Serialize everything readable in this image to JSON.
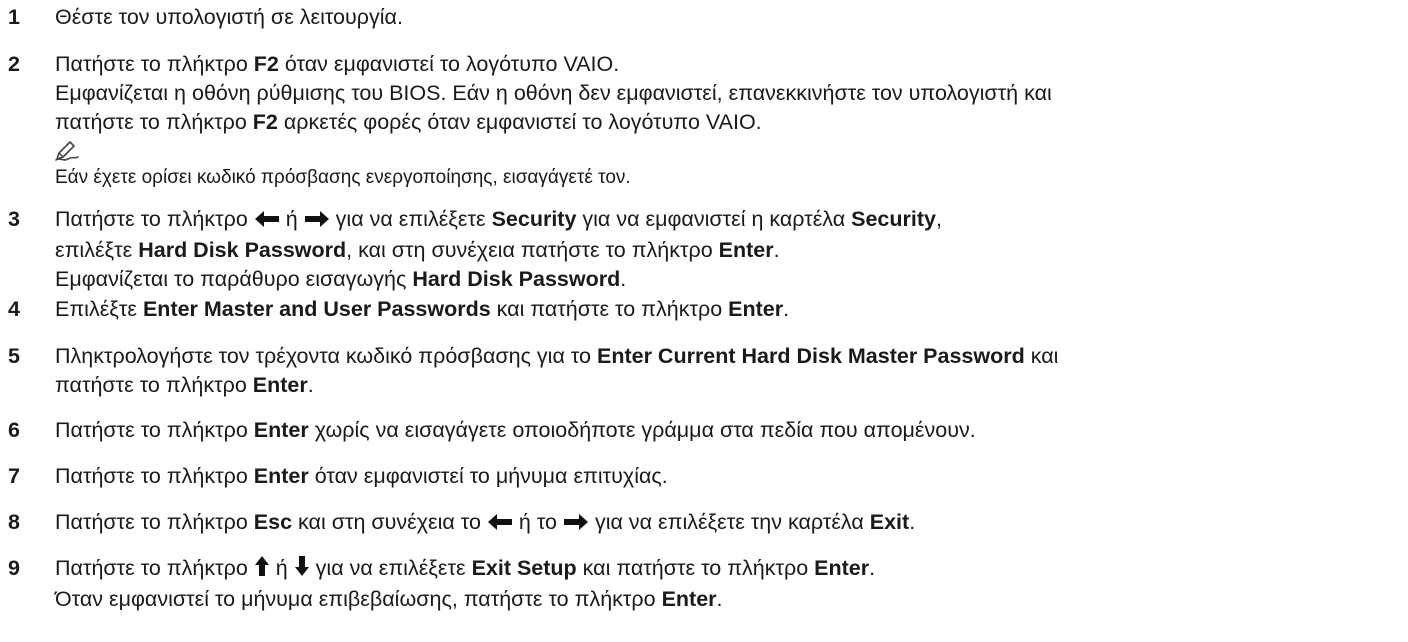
{
  "steps": [
    {
      "num": "1",
      "lines": [
        [
          "Θέστε τον υπολογιστή σε λειτουργία."
        ]
      ]
    },
    {
      "num": "2",
      "lines": [
        [
          "Πατήστε το πλήκτρο ",
          {
            "b": "F2"
          },
          " όταν εμφανιστεί το λογότυπο VAIO."
        ],
        [
          "Εμφανίζεται η οθόνη ρύθμισης του BIOS. Εάν η οθόνη δεν εμφανιστεί, επανεκκινήστε τον υπολογιστή και"
        ],
        [
          "πατήστε το πλήκτρο ",
          {
            "b": "F2"
          },
          " αρκετές φορές όταν εμφανιστεί το λογότυπο VAIO."
        ]
      ]
    },
    {
      "num": "3",
      "lines": [
        [
          "Πατήστε το πλήκτρο ",
          {
            "icon": "left-arrow-icon"
          },
          " ή ",
          {
            "icon": "right-arrow-icon"
          },
          " για να επιλέξετε ",
          {
            "b": "Security"
          },
          " για να εμφανιστεί η καρτέλα ",
          {
            "b": "Security"
          },
          ","
        ],
        [
          "επιλέξτε ",
          {
            "b": "Hard Disk Password"
          },
          ", και στη συνέχεια πατήστε το πλήκτρο ",
          {
            "b": "Enter"
          },
          "."
        ],
        [
          "Εμφανίζεται το παράθυρο εισαγωγής ",
          {
            "b": "Hard Disk Password"
          },
          "."
        ]
      ]
    },
    {
      "num": "4",
      "lines": [
        [
          "Επιλέξτε ",
          {
            "b": "Enter Master and User Passwords"
          },
          " και πατήστε το πλήκτρο ",
          {
            "b": "Enter"
          },
          "."
        ]
      ]
    },
    {
      "num": "5",
      "lines": [
        [
          "Πληκτρολογήστε τον τρέχοντα κωδικό πρόσβασης για το ",
          {
            "b": "Enter Current Hard Disk Master Password"
          },
          " και"
        ],
        [
          "πατήστε το πλήκτρο ",
          {
            "b": "Enter"
          },
          "."
        ]
      ]
    },
    {
      "num": "6",
      "lines": [
        [
          "Πατήστε το πλήκτρο ",
          {
            "b": "Enter"
          },
          " χωρίς να εισαγάγετε οποιοδήποτε γράμμα στα πεδία που απομένουν."
        ]
      ]
    },
    {
      "num": "7",
      "lines": [
        [
          "Πατήστε το πλήκτρο ",
          {
            "b": "Enter"
          },
          " όταν εμφανιστεί το μήνυμα επιτυχίας."
        ]
      ]
    },
    {
      "num": "8",
      "lines": [
        [
          "Πατήστε το πλήκτρο ",
          {
            "b": "Esc"
          },
          " και στη συνέχεια το ",
          {
            "icon": "left-arrow-icon"
          },
          " ή το ",
          {
            "icon": "right-arrow-icon"
          },
          " για να επιλέξετε την καρτέλα ",
          {
            "b": "Exit"
          },
          "."
        ]
      ]
    },
    {
      "num": "9",
      "lines": [
        [
          "Πατήστε το πλήκτρο ",
          {
            "icon": "up-arrow-icon"
          },
          " ή ",
          {
            "icon": "down-arrow-icon"
          },
          " για να επιλέξετε ",
          {
            "b": "Exit Setup"
          },
          " και πατήστε το πλήκτρο ",
          {
            "b": "Enter"
          },
          "."
        ],
        [
          "Όταν εμφανιστεί το μήνυμα επιβεβαίωσης, πατήστε το πλήκτρο ",
          {
            "b": "Enter"
          },
          "."
        ]
      ]
    }
  ],
  "note": {
    "icon": "pencil-note-icon",
    "text": "Εάν έχετε ορίσει κωδικό πρόσβασης ενεργοποίησης, εισαγάγετέ τον."
  }
}
